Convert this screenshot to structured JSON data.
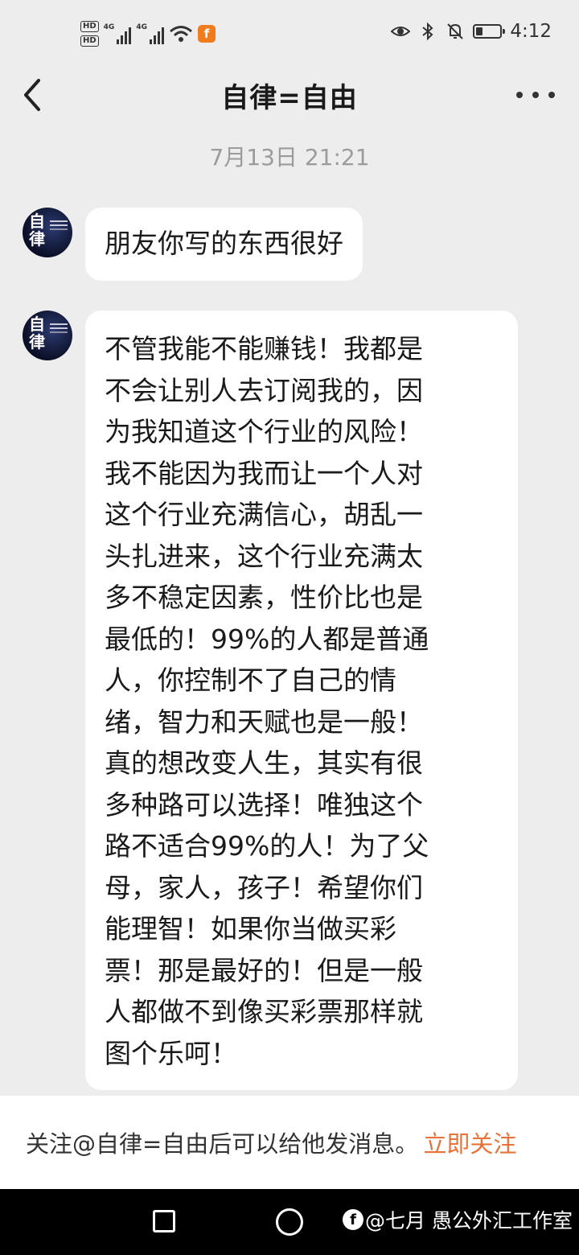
{
  "status_bar": {
    "sim1": "HD",
    "sim2": "HD",
    "network1": "4G",
    "network2": "4G",
    "app_badge": "f",
    "time": "4:12",
    "battery_level": 0.28,
    "icons": [
      "eye-icon",
      "bluetooth-icon",
      "mute-icon",
      "battery-icon"
    ]
  },
  "header": {
    "title": "自律=自由"
  },
  "chat": {
    "timestamp": "7月13日 21:21",
    "messages": [
      {
        "sender_avatar_text": [
          "自",
          "律"
        ],
        "text": "朋友你写的东西很好"
      },
      {
        "sender_avatar_text": [
          "自",
          "律"
        ],
        "text": "不管我能不能赚钱！我都是\n不会让别人去订阅我的，因\n为我知道这个行业的风险！\n我不能因为我而让一个人对\n这个行业充满信心，胡乱一\n头扎进来，这个行业充满太\n多不稳定因素，性价比也是\n最低的！99%的人都是普通\n人，你控制不了自己的情\n绪，智力和天赋也是一般！\n真的想改变人生，其实有很\n多种路可以选择！唯独这个\n路不适合99%的人！为了父\n母，家人，孩子！希望你们\n能理智！如果你当做买彩\n票！那是最好的！但是一般\n人都做不到像买彩票那样就\n图个乐呵！"
      }
    ]
  },
  "follow_bar": {
    "text": "关注@自律=自由后可以给他发消息。",
    "link": "立即关注",
    "link_color": "#e8733a"
  },
  "watermark": {
    "text": "@七月 愚公外汇工作室"
  }
}
